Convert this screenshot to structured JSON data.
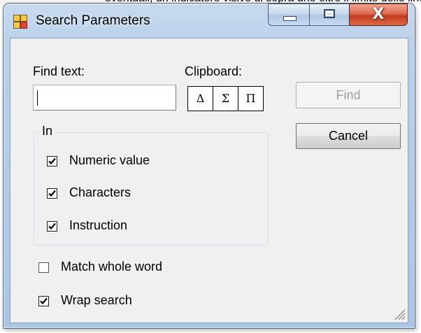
{
  "window": {
    "title": "Search Parameters"
  },
  "icons": {
    "app": "window-app-icon",
    "min": "minimize-icon",
    "max": "maximize-icon",
    "close": "close-icon",
    "grip": "resize-grip-icon"
  },
  "caption": {
    "close_glyph": "X"
  },
  "find_text": {
    "label": "Find text:",
    "value": ""
  },
  "clipboard": {
    "label": "Clipboard:",
    "symbols": [
      "Δ",
      "Σ",
      "Π"
    ]
  },
  "buttons": {
    "find": "Find",
    "cancel": "Cancel"
  },
  "in_group": {
    "label": "In",
    "options": [
      {
        "label": "Numeric value",
        "checked": true
      },
      {
        "label": "Characters",
        "checked": true
      },
      {
        "label": "Instruction",
        "checked": true
      }
    ]
  },
  "match_whole_word": {
    "label": "Match whole word",
    "checked": false
  },
  "wrap_search": {
    "label": "Wrap search",
    "checked": true
  }
}
